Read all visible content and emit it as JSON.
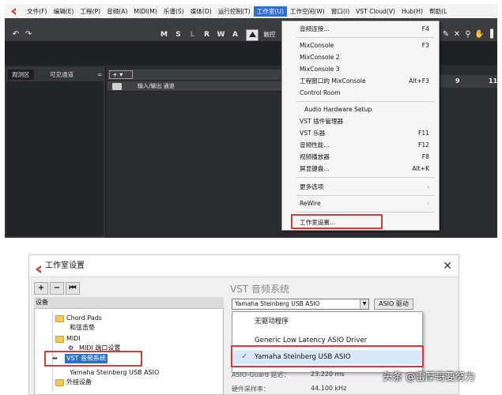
{
  "menubar": {
    "items": [
      "文件(F)",
      "编辑(E)",
      "工程(P)",
      "音频(A)",
      "MIDI(M)",
      "乐谱(S)",
      "媒体(D)",
      "运行控制(T)",
      "工作室(U)",
      "工作空间(W)",
      "窗口(I)",
      "VST Cloud(V)",
      "Hub(H)",
      "帮助(L"
    ],
    "active_index": 8
  },
  "toolbar": {
    "undo": "↶",
    "redo": "↷",
    "m": "M",
    "s": "S",
    "l": "L",
    "r": "R",
    "w": "W",
    "a": "A",
    "touch_label": "触控"
  },
  "left_panel": {
    "tab1": "观测区",
    "tab2": "可见通道",
    "menu_icon": "="
  },
  "track_area": {
    "add_label": "+ ▾",
    "track_name": "输入/输出 通道"
  },
  "ruler": {
    "n9": "9",
    "n11": "11"
  },
  "studio_menu": {
    "items": [
      {
        "label": "音频连接...",
        "shortcut": "F4"
      },
      {
        "label": "MixConsole",
        "shortcut": "F3"
      },
      {
        "label": "MixConsole 2",
        "shortcut": ""
      },
      {
        "label": "MixConsole 3",
        "shortcut": ""
      },
      {
        "label": "工程窗口的 MixConsole",
        "shortcut": "Alt+F3"
      },
      {
        "label": "Control Room",
        "shortcut": ""
      },
      {
        "label": "Audio Hardware Setup",
        "shortcut": ""
      },
      {
        "label": "VST 插件管理器",
        "shortcut": ""
      },
      {
        "label": "VST 乐器",
        "shortcut": "F11"
      },
      {
        "label": "音频性能...",
        "shortcut": "F12"
      },
      {
        "label": "视频播放器",
        "shortcut": "F8"
      },
      {
        "label": "屏显键盘...",
        "shortcut": "Alt+K"
      },
      {
        "label": "更多选项",
        "shortcut": "›"
      },
      {
        "label": "ReWire",
        "shortcut": "›"
      },
      {
        "label": "工作室设置...",
        "shortcut": ""
      }
    ]
  },
  "studio_setup": {
    "title": "工作室设置",
    "close": "✕",
    "tools": [
      "+",
      "−",
      "⏮"
    ],
    "tree_header": "设备",
    "tree": {
      "chord_pads": "Chord Pads",
      "chord_sub": "和弦击垫",
      "midi": "MIDI",
      "midi_port": "MIDI 端口设置",
      "vst_audio": "VST 音频系统",
      "yamaha": "Yamaha Steinberg USB ASIO",
      "external": "外挂设备"
    },
    "panel_title": "VST 音频系统",
    "driver_value": "Yamaha Steinberg USB ASIO",
    "asio_button": "ASIO 驱动",
    "driver_options": [
      "无驱动程序",
      "Generic Low Latency ASIO Driver",
      "Yamaha Steinberg USB ASIO"
    ],
    "asio_guard_label": "ASIO-Guard 延迟：",
    "asio_guard_value": "23.220 ms",
    "hw_rate_label": "硬件采样率：",
    "hw_rate_value": "44.100 kHz"
  },
  "watermark": "头条 @雷厚哥要努力",
  "colors": {
    "highlight": "#d23b3b",
    "menu_active": "#2f6fd0",
    "tree_selected": "#2e6fc6"
  }
}
